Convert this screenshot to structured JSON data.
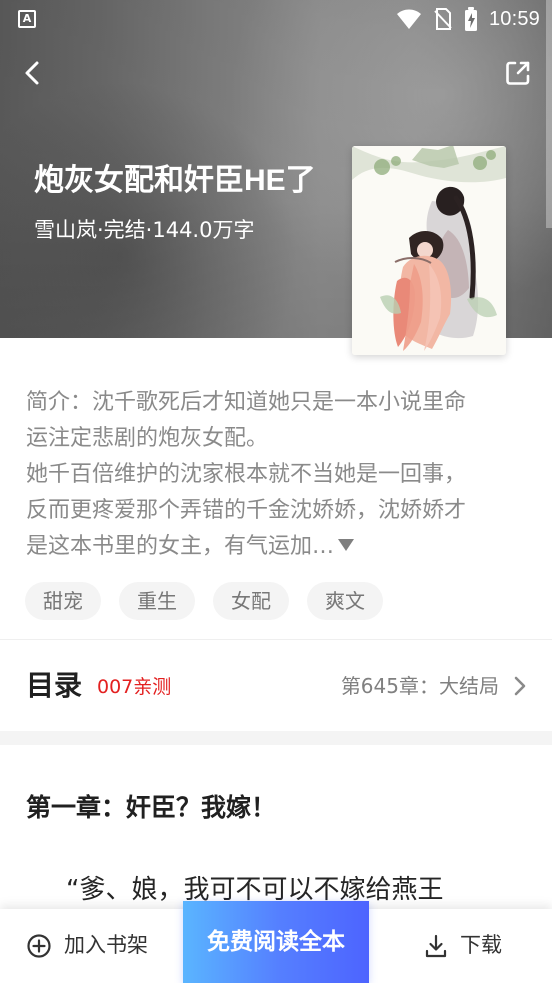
{
  "status_bar": {
    "left_icon": "A",
    "time": "10:59",
    "icons": [
      "wifi-icon",
      "no-sim-icon",
      "battery-charging-icon"
    ]
  },
  "header": {
    "back_icon": "chevron-left-icon",
    "share_icon": "share-icon",
    "title": "炮灰女配和奸臣HE了",
    "meta": "雪山岚·完结·144.0万字",
    "cover_icon": "book-cover-illustration"
  },
  "summary": {
    "lines": [
      "简介：沈千歌死后才知道她只是一本小说里命",
      "运注定悲剧的炮灰女配。",
      "她千百倍维护的沈家根本就不当她是一回事，",
      "反而更疼爱那个弄错的千金沈娇娇，沈娇娇才",
      "是这本书里的女主，有气运加…"
    ],
    "expand_icon": "triangle-down-icon"
  },
  "tags": [
    "甜宠",
    "重生",
    "女配",
    "爽文"
  ],
  "catalog": {
    "title": "目录",
    "badge": "007亲测",
    "latest": "第645章：大结局",
    "chevron_icon": "chevron-right-icon"
  },
  "chapter": {
    "title": "第一章：奸臣？我嫁！",
    "first_line": "“爹、娘，我可不可以不嫁给燕王"
  },
  "bottom_bar": {
    "shelf_label": "加入书架",
    "read_label": "免费阅读全本",
    "download_label": "下载",
    "shelf_icon": "plus-circle-icon",
    "download_icon": "download-icon"
  },
  "colors": {
    "accent": "#557fff",
    "badge": "#e32020",
    "summary_text": "#8a8a8a",
    "tag_background": "#f4f4f4"
  }
}
